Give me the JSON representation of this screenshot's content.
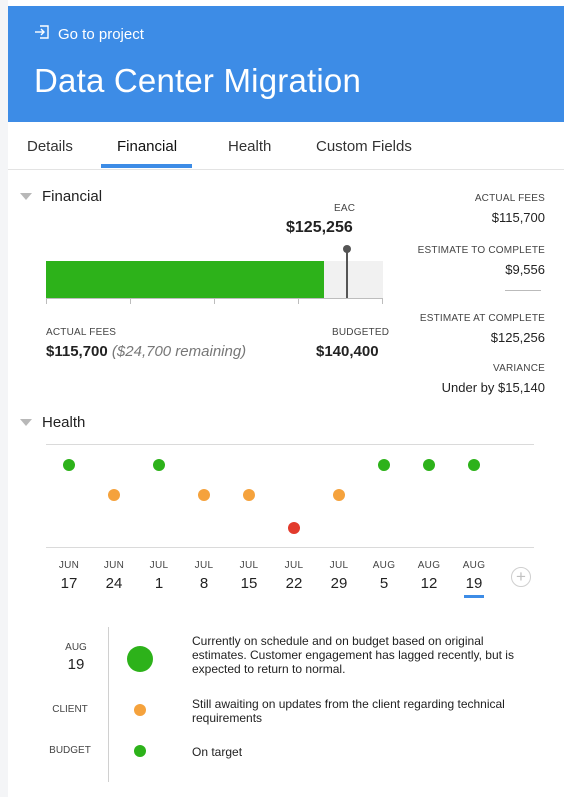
{
  "header": {
    "goto_label": "Go to project",
    "title": "Data Center Migration",
    "bg_color": "#3d8ce6"
  },
  "tabs": [
    {
      "label": "Details",
      "active": false
    },
    {
      "label": "Financial",
      "active": true
    },
    {
      "label": "Health",
      "active": false
    },
    {
      "label": "Custom Fields",
      "active": false
    }
  ],
  "financial": {
    "section_title": "Financial",
    "eac_label": "EAC",
    "eac_value": "$125,256",
    "actual_fees_label": "ACTUAL FEES",
    "actual_fees_value": "$115,700",
    "remaining_text": "($24,700 remaining)",
    "budgeted_label": "BUDGETED",
    "budgeted_value": "$140,400",
    "bar_fill_fraction": 0.824,
    "eac_fraction": 0.892,
    "bar_color": "#2db21a",
    "summary": {
      "actual_fees_label": "ACTUAL FEES",
      "actual_fees_value": "$115,700",
      "etc_label": "ESTIMATE TO COMPLETE",
      "etc_value": "$9,556",
      "eac_label": "ESTIMATE AT COMPLETE",
      "eac_value": "$125,256",
      "variance_label": "VARIANCE",
      "variance_value": "Under by $15,140"
    }
  },
  "health": {
    "section_title": "Health",
    "colors": {
      "good": "#2db21a",
      "warn": "#f5a23c",
      "bad": "#e23a2c"
    },
    "timeline": [
      {
        "month": "JUN",
        "day": "17",
        "status": "good"
      },
      {
        "month": "JUN",
        "day": "24",
        "status": "warn"
      },
      {
        "month": "JUL",
        "day": "1",
        "status": "good"
      },
      {
        "month": "JUL",
        "day": "8",
        "status": "warn"
      },
      {
        "month": "JUL",
        "day": "15",
        "status": "warn"
      },
      {
        "month": "JUL",
        "day": "22",
        "status": "bad"
      },
      {
        "month": "JUL",
        "day": "29",
        "status": "warn"
      },
      {
        "month": "AUG",
        "day": "5",
        "status": "good"
      },
      {
        "month": "AUG",
        "day": "12",
        "status": "good"
      },
      {
        "month": "AUG",
        "day": "19",
        "status": "good",
        "selected": true
      }
    ],
    "add_icon": "plus-circle-icon",
    "detail": {
      "month": "AUG",
      "day": "19",
      "overall_status": "good",
      "overall_note": "Currently on schedule and on budget based on original estimates. Customer engagement has lagged recently, but is expected to return to normal.",
      "rows": [
        {
          "label": "CLIENT",
          "status": "warn",
          "note": "Still awaiting on updates from the client regarding technical requirements"
        },
        {
          "label": "BUDGET",
          "status": "good",
          "note": "On target"
        }
      ]
    }
  }
}
